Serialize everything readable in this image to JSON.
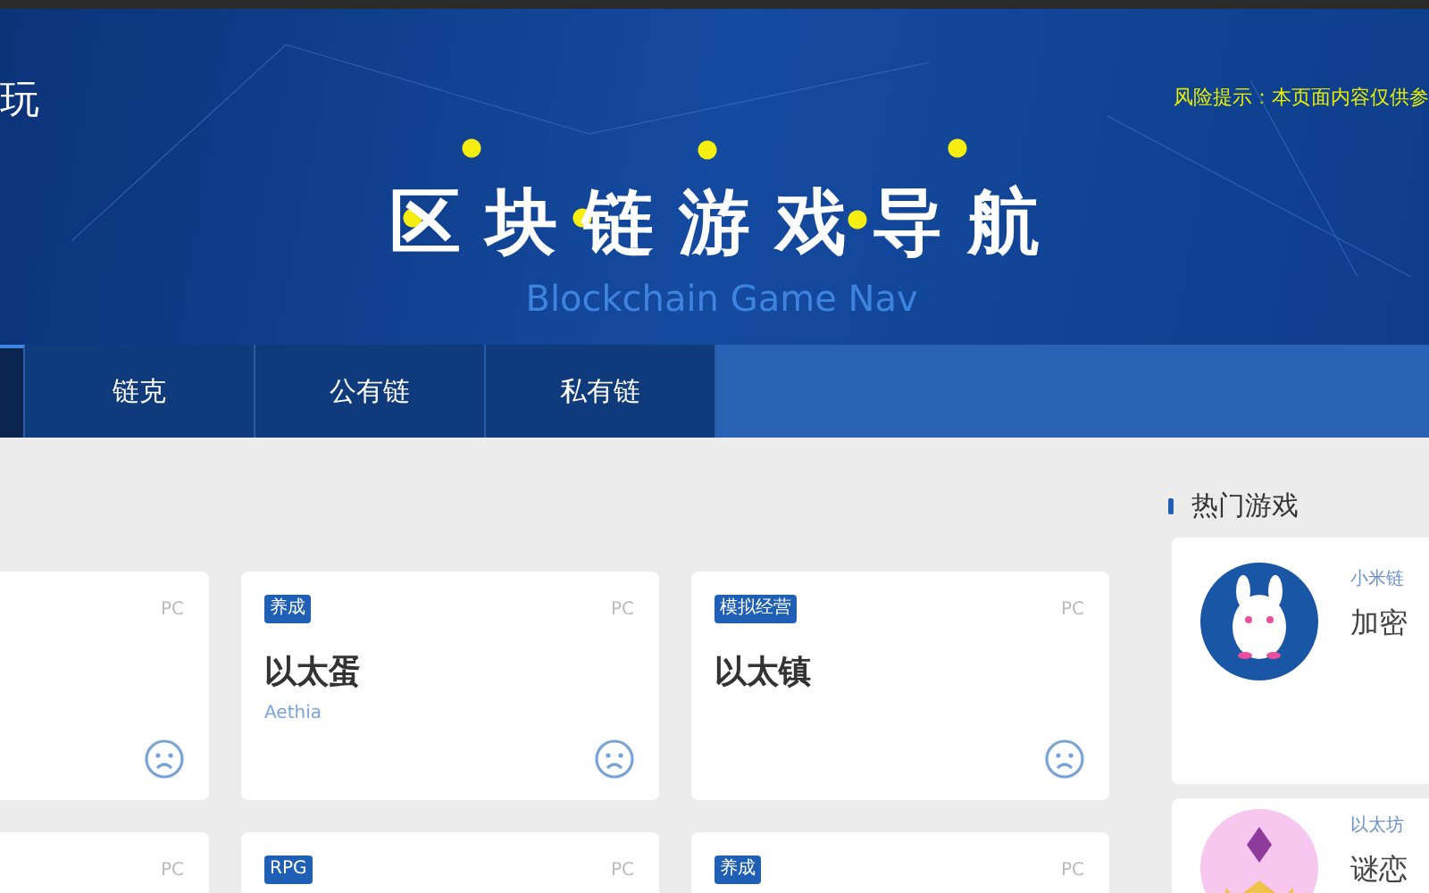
{
  "header": {
    "logo": "玩",
    "risk_notice": "风险提示：本页面内容仅供参",
    "title": "区块链游戏导航",
    "subtitle": "Blockchain Game Nav"
  },
  "tabs": [
    {
      "selected": true
    },
    {
      "label": "链克",
      "selected": false
    },
    {
      "label": "公有链",
      "selected": false
    },
    {
      "label": "私有链",
      "selected": false
    }
  ],
  "games": [
    {
      "platform": "PC"
    },
    {
      "tag": "养成",
      "platform": "PC",
      "title": "以太蛋",
      "subtitle": "Aethia"
    },
    {
      "tag": "模拟经营",
      "platform": "PC",
      "title": "以太镇"
    },
    {
      "platform": "PC"
    },
    {
      "tag": "RPG",
      "platform": "PC"
    },
    {
      "tag": "养成",
      "platform": "PC"
    }
  ],
  "hot_games": {
    "heading": "热门游戏",
    "items": [
      {
        "kind": "rabbit",
        "chain": "小米链",
        "name": "加密"
      },
      {
        "kind": "cat",
        "chain": "以太坊",
        "name": "谜恋"
      }
    ]
  }
}
